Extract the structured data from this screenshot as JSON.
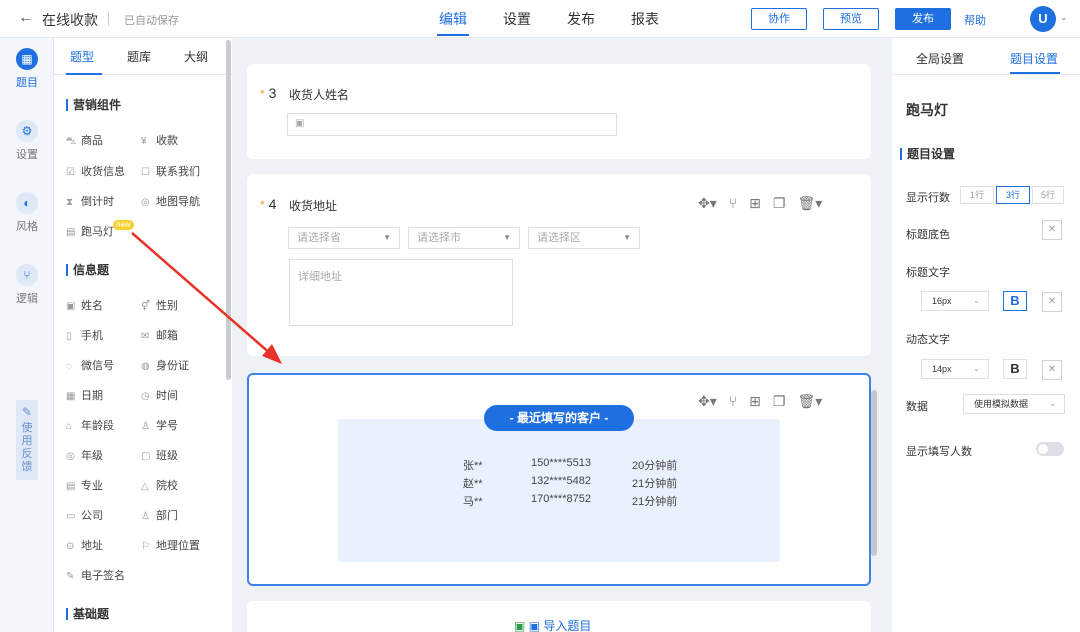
{
  "header": {
    "back_icon": "arrow-left-icon",
    "title": "在线收款",
    "autosave": "已自动保存",
    "tabs": [
      {
        "label": "编辑",
        "active": true
      },
      {
        "label": "设置",
        "active": false
      },
      {
        "label": "发布",
        "active": false
      },
      {
        "label": "报表",
        "active": false
      }
    ],
    "buttons": {
      "collab": "协作",
      "preview": "预览",
      "publish": "发布",
      "help": "帮助"
    },
    "avatar_letter": "U"
  },
  "left_nav": {
    "items": [
      {
        "label": "题目",
        "icon": "grid-icon",
        "glyph": "▦",
        "active": true
      },
      {
        "label": "设置",
        "icon": "gear-icon",
        "glyph": "⚙",
        "active": false
      },
      {
        "label": "风格",
        "icon": "palette-icon",
        "glyph": "◐",
        "active": false
      },
      {
        "label": "逻辑",
        "icon": "branch-icon",
        "glyph": "⑂",
        "active": false
      }
    ],
    "feedback_label": "使用反馈"
  },
  "left_panel": {
    "tabs": [
      "题型",
      "题库",
      "大纲"
    ],
    "sections": {
      "marketing": "营销组件",
      "info": "信息题",
      "basic": "基础题"
    },
    "marketing_items": [
      "商品",
      "收款",
      "收货信息",
      "联系我们",
      "倒计时",
      "地图导航",
      "跑马灯"
    ],
    "info_items": [
      "姓名",
      "性别",
      "手机",
      "邮箱",
      "微信号",
      "身份证",
      "日期",
      "时间",
      "年龄段",
      "学号",
      "年级",
      "班级",
      "专业",
      "院校",
      "公司",
      "部门",
      "地址",
      "地理位置",
      "电子签名"
    ],
    "new_badge": "new"
  },
  "canvas": {
    "q3": {
      "num": "3",
      "title": "收货人姓名"
    },
    "q4": {
      "num": "4",
      "title": "收货地址",
      "province": "请选择省",
      "city": "请选择市",
      "district": "请选择区",
      "detail": "详细地址"
    },
    "marquee": {
      "title": "- 最近填写的客户 -",
      "rows": [
        {
          "name": "张**",
          "phone": "150****5513",
          "time": "20分钟前"
        },
        {
          "name": "赵**",
          "phone": "132****5482",
          "time": "21分钟前"
        },
        {
          "name": "马**",
          "phone": "170****8752",
          "time": "21分钟前"
        }
      ]
    },
    "import_label": "导入题目"
  },
  "right_panel": {
    "tabs": [
      "全局设置",
      "题目设置"
    ],
    "component_title": "跑马灯",
    "section": "题目设置",
    "rows_label": "显示行数",
    "row_options": [
      {
        "label": "1行",
        "active": false
      },
      {
        "label": "3行",
        "active": true
      },
      {
        "label": "5行",
        "active": false
      }
    ],
    "title_bg_label": "标题底色",
    "title_text_label": "标题文字",
    "title_font_size": "16px",
    "dynamic_text_label": "动态文字",
    "dynamic_font_size": "14px",
    "bold_label": "B",
    "data_label": "数据",
    "data_value": "使用模拟数据",
    "show_count_label": "显示填写人数",
    "show_count_on": false
  },
  "colors": {
    "accent": "#1e6fe0",
    "new_badge": "#f7d02c",
    "arrow": "#e8322a",
    "star": "#f0a020"
  }
}
